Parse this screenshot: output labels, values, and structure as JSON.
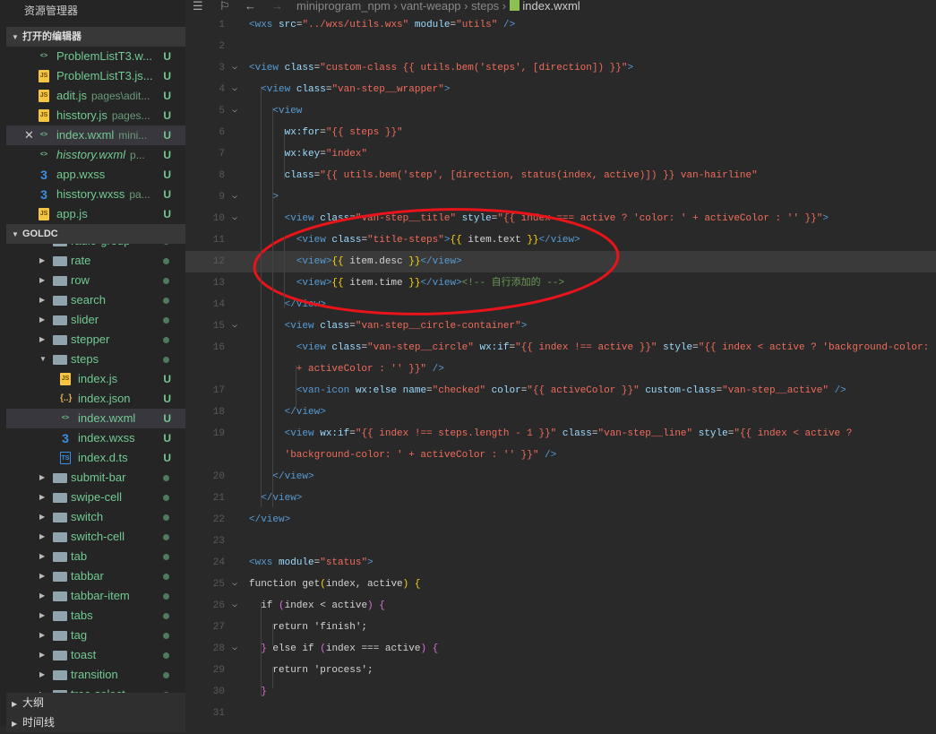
{
  "sidebar": {
    "title": "资源管理器",
    "open_editors_label": "打开的编辑器",
    "open_editors": [
      {
        "name": "ProblemListT3.w...",
        "desc": "",
        "icon": "wxml-file-icon",
        "status": "U",
        "italic": false
      },
      {
        "name": "ProblemListT3.js...",
        "desc": "",
        "icon": "js-file-icon",
        "status": "U",
        "italic": false
      },
      {
        "name": "adit.js",
        "desc": "pages\\adit...",
        "icon": "js-file-icon",
        "status": "U",
        "italic": false
      },
      {
        "name": "hisstory.js",
        "desc": "pages...",
        "icon": "js-file-icon",
        "status": "U",
        "italic": false
      },
      {
        "name": "index.wxml",
        "desc": "mini...",
        "icon": "wxml-file-icon",
        "status": "U",
        "italic": false,
        "active": true
      },
      {
        "name": "hisstory.wxml",
        "desc": "p...",
        "icon": "wxml-file-icon",
        "status": "U",
        "italic": true
      },
      {
        "name": "app.wxss",
        "desc": "",
        "icon": "css-file-icon",
        "status": "U",
        "italic": false
      },
      {
        "name": "hisstory.wxss",
        "desc": "pa...",
        "icon": "css-file-icon",
        "status": "U",
        "italic": false
      },
      {
        "name": "app.js",
        "desc": "",
        "icon": "js-file-icon",
        "status": "U",
        "italic": false
      }
    ],
    "project_label": "GOLDC",
    "tree": [
      {
        "name": "radio-group",
        "type": "folder"
      },
      {
        "name": "rate",
        "type": "folder"
      },
      {
        "name": "row",
        "type": "folder"
      },
      {
        "name": "search",
        "type": "folder"
      },
      {
        "name": "slider",
        "type": "folder"
      },
      {
        "name": "stepper",
        "type": "folder"
      },
      {
        "name": "steps",
        "type": "folder",
        "open": true
      },
      {
        "name": "index.js",
        "type": "js",
        "status": "U"
      },
      {
        "name": "index.json",
        "type": "json",
        "status": "U"
      },
      {
        "name": "index.wxml",
        "type": "wxml",
        "status": "U",
        "selected": true
      },
      {
        "name": "index.wxss",
        "type": "css",
        "status": "U"
      },
      {
        "name": "index.d.ts",
        "type": "ts",
        "status": "U"
      },
      {
        "name": "submit-bar",
        "type": "folder"
      },
      {
        "name": "swipe-cell",
        "type": "folder"
      },
      {
        "name": "switch",
        "type": "folder"
      },
      {
        "name": "switch-cell",
        "type": "folder"
      },
      {
        "name": "tab",
        "type": "folder"
      },
      {
        "name": "tabbar",
        "type": "folder"
      },
      {
        "name": "tabbar-item",
        "type": "folder"
      },
      {
        "name": "tabs",
        "type": "folder"
      },
      {
        "name": "tag",
        "type": "folder"
      },
      {
        "name": "toast",
        "type": "folder"
      },
      {
        "name": "transition",
        "type": "folder"
      },
      {
        "name": "tree-select",
        "type": "folder"
      }
    ],
    "outline_label": "大纲",
    "timeline_label": "时间线"
  },
  "breadcrumb": [
    "miniprogram_npm",
    "vant-weapp",
    "steps",
    "index.wxml"
  ],
  "annotation_color": "#e8141a",
  "code": [
    {
      "n": "1",
      "seg": [
        [
          "t",
          "<wxs "
        ],
        [
          "a",
          "src"
        ],
        [
          "p",
          "="
        ],
        [
          "s",
          "\"../wxs/utils.wxs\""
        ],
        [
          "a",
          " module"
        ],
        [
          "p",
          "="
        ],
        [
          "s",
          "\"utils\""
        ],
        [
          "t",
          " />"
        ]
      ]
    },
    {
      "n": "2",
      "seg": []
    },
    {
      "n": "3",
      "f": 1,
      "seg": [
        [
          "t",
          "<view "
        ],
        [
          "a",
          "class"
        ],
        [
          "p",
          "="
        ],
        [
          "s",
          "\"custom-class {{ utils.bem('steps', [direction]) }}\""
        ],
        [
          "t",
          ">"
        ]
      ]
    },
    {
      "n": "4",
      "f": 1,
      "seg": [
        [
          "p",
          "  "
        ],
        [
          "t",
          "<view "
        ],
        [
          "a",
          "class"
        ],
        [
          "p",
          "="
        ],
        [
          "s",
          "\"van-step__wrapper\""
        ],
        [
          "t",
          ">"
        ]
      ]
    },
    {
      "n": "5",
      "f": 1,
      "seg": [
        [
          "p",
          "    "
        ],
        [
          "t",
          "<view"
        ]
      ]
    },
    {
      "n": "6",
      "seg": [
        [
          "a",
          "      wx:for"
        ],
        [
          "p",
          "="
        ],
        [
          "s",
          "\"{{ steps }}\""
        ]
      ]
    },
    {
      "n": "7",
      "seg": [
        [
          "a",
          "      wx:key"
        ],
        [
          "p",
          "="
        ],
        [
          "s",
          "\"index\""
        ]
      ]
    },
    {
      "n": "8",
      "seg": [
        [
          "a",
          "      class"
        ],
        [
          "p",
          "="
        ],
        [
          "s",
          "\"{{ utils.bem('step', [direction, status(index, active)]) }} van-hairline\""
        ]
      ]
    },
    {
      "n": "9",
      "f": 1,
      "seg": [
        [
          "t",
          "    >"
        ]
      ]
    },
    {
      "n": "10",
      "f": 1,
      "seg": [
        [
          "p",
          "      "
        ],
        [
          "t",
          "<view "
        ],
        [
          "a",
          "class"
        ],
        [
          "p",
          "="
        ],
        [
          "s",
          "\"van-step__title\""
        ],
        [
          "a",
          " style"
        ],
        [
          "p",
          "="
        ],
        [
          "s",
          "\"{{ index === active ? 'color: ' + activeColor : '' }}\""
        ],
        [
          "t",
          ">"
        ]
      ]
    },
    {
      "n": "11",
      "seg": [
        [
          "p",
          "        "
        ],
        [
          "t",
          "<view "
        ],
        [
          "a",
          "class"
        ],
        [
          "p",
          "="
        ],
        [
          "s",
          "\"title-steps\""
        ],
        [
          "t",
          ">"
        ],
        [
          "y",
          "{{"
        ],
        [
          "p",
          " item.text "
        ],
        [
          "y",
          "}}"
        ],
        [
          "t",
          "</view>"
        ]
      ]
    },
    {
      "n": "12",
      "hl": 1,
      "seg": [
        [
          "p",
          "        "
        ],
        [
          "t",
          "<view>"
        ],
        [
          "y",
          "{{"
        ],
        [
          "p",
          " item.desc "
        ],
        [
          "y",
          "}}"
        ],
        [
          "t",
          "</view>"
        ]
      ]
    },
    {
      "n": "13",
      "seg": [
        [
          "p",
          "        "
        ],
        [
          "t",
          "<view>"
        ],
        [
          "y",
          "{{"
        ],
        [
          "p",
          " item.time "
        ],
        [
          "y",
          "}}"
        ],
        [
          "t",
          "</view>"
        ],
        [
          "c",
          "<!-- 自行添加的 -->"
        ]
      ]
    },
    {
      "n": "14",
      "seg": [
        [
          "t",
          "      </view>"
        ]
      ]
    },
    {
      "n": "15",
      "f": 1,
      "seg": [
        [
          "p",
          "      "
        ],
        [
          "t",
          "<view "
        ],
        [
          "a",
          "class"
        ],
        [
          "p",
          "="
        ],
        [
          "s",
          "\"van-step__circle-container\""
        ],
        [
          "t",
          ">"
        ]
      ]
    },
    {
      "n": "16",
      "seg": [
        [
          "p",
          "        "
        ],
        [
          "t",
          "<view "
        ],
        [
          "a",
          "class"
        ],
        [
          "p",
          "="
        ],
        [
          "s",
          "\"van-step__circle\""
        ],
        [
          "a",
          " wx:if"
        ],
        [
          "p",
          "="
        ],
        [
          "s",
          "\"{{ index !== active }}\""
        ],
        [
          "a",
          " style"
        ],
        [
          "p",
          "="
        ],
        [
          "s",
          "\"{{ index < active ? 'background-color: '"
        ]
      ]
    },
    {
      "n": "",
      "seg": [
        [
          "s",
          "        + activeColor : '' }}\""
        ],
        [
          "t",
          " />"
        ]
      ]
    },
    {
      "n": "17",
      "seg": [
        [
          "p",
          "        "
        ],
        [
          "t",
          "<van-icon "
        ],
        [
          "a",
          "wx:else name"
        ],
        [
          "p",
          "="
        ],
        [
          "s",
          "\"checked\""
        ],
        [
          "a",
          " color"
        ],
        [
          "p",
          "="
        ],
        [
          "s",
          "\"{{ activeColor }}\""
        ],
        [
          "a",
          " custom-class"
        ],
        [
          "p",
          "="
        ],
        [
          "s",
          "\"van-step__active\""
        ],
        [
          "t",
          " />"
        ]
      ]
    },
    {
      "n": "18",
      "seg": [
        [
          "t",
          "      </view>"
        ]
      ]
    },
    {
      "n": "19",
      "seg": [
        [
          "p",
          "      "
        ],
        [
          "t",
          "<view "
        ],
        [
          "a",
          "wx:if"
        ],
        [
          "p",
          "="
        ],
        [
          "s",
          "\"{{ index !== steps.length - 1 }}\""
        ],
        [
          "a",
          " class"
        ],
        [
          "p",
          "="
        ],
        [
          "s",
          "\"van-step__line\""
        ],
        [
          "a",
          " style"
        ],
        [
          "p",
          "="
        ],
        [
          "s",
          "\"{{ index < active ?"
        ]
      ]
    },
    {
      "n": "",
      "seg": [
        [
          "s",
          "      'background-color: ' + activeColor : '' }}\""
        ],
        [
          "t",
          " />"
        ]
      ]
    },
    {
      "n": "20",
      "seg": [
        [
          "t",
          "    </view>"
        ]
      ]
    },
    {
      "n": "21",
      "seg": [
        [
          "t",
          "  </view>"
        ]
      ]
    },
    {
      "n": "22",
      "seg": [
        [
          "t",
          "</view>"
        ]
      ]
    },
    {
      "n": "23",
      "seg": []
    },
    {
      "n": "24",
      "seg": [
        [
          "t",
          "<wxs "
        ],
        [
          "a",
          "module"
        ],
        [
          "p",
          "="
        ],
        [
          "s",
          "\"status\""
        ],
        [
          "t",
          ">"
        ]
      ]
    },
    {
      "n": "25",
      "f": 1,
      "seg": [
        [
          "p",
          "function get"
        ],
        [
          "y",
          "("
        ],
        [
          "p",
          "index, active"
        ],
        [
          "y",
          ")"
        ],
        [
          "p",
          " "
        ],
        [
          "y",
          "{"
        ]
      ]
    },
    {
      "n": "26",
      "f": 1,
      "seg": [
        [
          "p",
          "  if "
        ],
        [
          "m",
          "("
        ],
        [
          "p",
          "index < active"
        ],
        [
          "m",
          ")"
        ],
        [
          "p",
          " "
        ],
        [
          "m",
          "{"
        ]
      ]
    },
    {
      "n": "27",
      "seg": [
        [
          "p",
          "    return 'finish';"
        ]
      ]
    },
    {
      "n": "28",
      "f": 1,
      "seg": [
        [
          "m",
          "  }"
        ],
        [
          "p",
          " else if "
        ],
        [
          "m",
          "("
        ],
        [
          "p",
          "index === active"
        ],
        [
          "m",
          ")"
        ],
        [
          "p",
          " "
        ],
        [
          "m",
          "{"
        ]
      ]
    },
    {
      "n": "29",
      "seg": [
        [
          "p",
          "    return 'process';"
        ]
      ]
    },
    {
      "n": "30",
      "seg": [
        [
          "m",
          "  }"
        ]
      ]
    },
    {
      "n": "31",
      "seg": []
    }
  ]
}
